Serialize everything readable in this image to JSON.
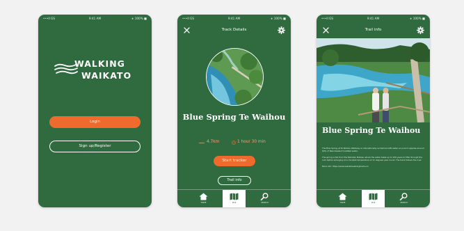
{
  "status_bar": {
    "carrier": "•••ll GS",
    "time": "9:41 AM",
    "battery": "∗ 100% ■"
  },
  "login_screen": {
    "logo_line1": "WALKING",
    "logo_line2": "WAIKATO",
    "login_label": "Login",
    "signup_label": "Sign up/Register"
  },
  "track_screen": {
    "header_title": "Track Details",
    "title": "Blue Spring Te Waihou",
    "distance": "4.7km",
    "duration": "1 hour 30 min",
    "start_label": "Start tracker",
    "trail_info_label": "Trail info"
  },
  "info_screen": {
    "header_title": "Trail info",
    "title": "Blue Spring Te Waihou",
    "paragraphs": [
      "The Blue Spring at Te Waihou Walkway is internationally acclaimed with water so pure it supplies around 60% of New Zealand's bottled water.",
      "The spring is fed from the Mamaku Plateau where the water takes up to 100 years to filter through the rock before emerging at a constant temperature of 11 degrees year round. The track follows the river.",
      "More info: https://www.waikatowalkingtracks.nz"
    ]
  },
  "tabbar": {
    "home": "HOME",
    "map": "MAP",
    "search": "SEARCH"
  },
  "colors": {
    "screen_green": "#2f6b3f",
    "accent_orange": "#ef6a2d",
    "stat_orange": "#f6a37b",
    "background": "#f1f2f1"
  },
  "icons": [
    "close-icon",
    "gear-icon",
    "path-icon",
    "clock-icon",
    "home-icon",
    "map-icon",
    "search-icon",
    "logo-waves-icon"
  ]
}
